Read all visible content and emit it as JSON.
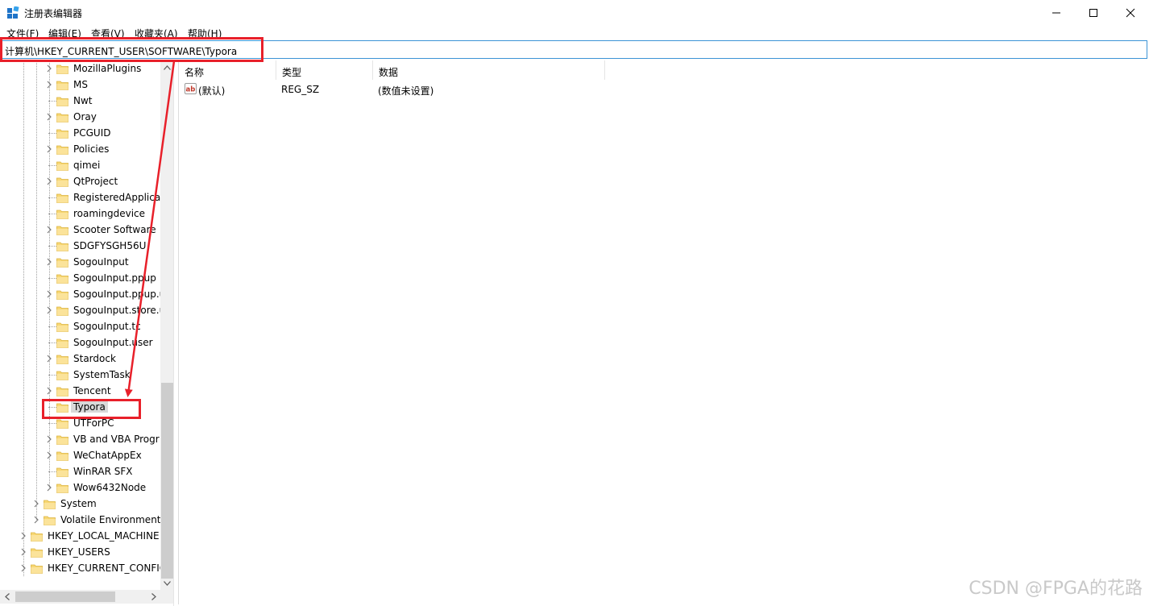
{
  "window": {
    "title": "注册表编辑器",
    "controls": [
      "minimize",
      "maximize",
      "close"
    ]
  },
  "menu": [
    "文件(F)",
    "编辑(E)",
    "查看(V)",
    "收藏夹(A)",
    "帮助(H)"
  ],
  "address": "计算机\\HKEY_CURRENT_USER\\SOFTWARE\\Typora",
  "tree": [
    {
      "label": "MozillaPlugins",
      "level": 3,
      "expandable": true
    },
    {
      "label": "MS",
      "level": 3,
      "expandable": true
    },
    {
      "label": "Nwt",
      "level": 3,
      "expandable": false
    },
    {
      "label": "Oray",
      "level": 3,
      "expandable": true
    },
    {
      "label": "PCGUID",
      "level": 3,
      "expandable": false
    },
    {
      "label": "Policies",
      "level": 3,
      "expandable": true
    },
    {
      "label": "qimei",
      "level": 3,
      "expandable": false
    },
    {
      "label": "QtProject",
      "level": 3,
      "expandable": true
    },
    {
      "label": "RegisteredApplica",
      "level": 3,
      "expandable": false
    },
    {
      "label": "roamingdevice",
      "level": 3,
      "expandable": false
    },
    {
      "label": "Scooter Software",
      "level": 3,
      "expandable": true
    },
    {
      "label": "SDGFYSGH56U",
      "level": 3,
      "expandable": false
    },
    {
      "label": "SogouInput",
      "level": 3,
      "expandable": true
    },
    {
      "label": "SogouInput.ppup",
      "level": 3,
      "expandable": false
    },
    {
      "label": "SogouInput.ppup.u",
      "level": 3,
      "expandable": true
    },
    {
      "label": "SogouInput.store.u",
      "level": 3,
      "expandable": true
    },
    {
      "label": "SogouInput.tc",
      "level": 3,
      "expandable": false
    },
    {
      "label": "SogouInput.user",
      "level": 3,
      "expandable": false
    },
    {
      "label": "Stardock",
      "level": 3,
      "expandable": true
    },
    {
      "label": "SystemTask",
      "level": 3,
      "expandable": false
    },
    {
      "label": "Tencent",
      "level": 3,
      "expandable": true
    },
    {
      "label": "Typora",
      "level": 3,
      "expandable": false,
      "selected": true
    },
    {
      "label": "UTForPC",
      "level": 3,
      "expandable": false
    },
    {
      "label": "VB and VBA Progr",
      "level": 3,
      "expandable": true
    },
    {
      "label": "WeChatAppEx",
      "level": 3,
      "expandable": true
    },
    {
      "label": "WinRAR SFX",
      "level": 3,
      "expandable": false
    },
    {
      "label": "Wow6432Node",
      "level": 3,
      "expandable": true
    },
    {
      "label": "System",
      "level": 2,
      "expandable": true
    },
    {
      "label": "Volatile Environment",
      "level": 2,
      "expandable": true
    },
    {
      "label": "HKEY_LOCAL_MACHINE",
      "level": 1,
      "expandable": true
    },
    {
      "label": "HKEY_USERS",
      "level": 1,
      "expandable": true
    },
    {
      "label": "HKEY_CURRENT_CONFIG",
      "level": 1,
      "expandable": true
    }
  ],
  "list": {
    "columns": [
      "名称",
      "类型",
      "数据"
    ],
    "rows": [
      {
        "icon": "string-value-icon",
        "name": "(默认)",
        "type": "REG_SZ",
        "data": "(数值未设置)"
      }
    ]
  },
  "watermark": "CSDN @FPGA的花路",
  "colors": {
    "annotation": "#e8202a",
    "selection": "#d9d9d9",
    "address_border": "#3c94d6"
  }
}
